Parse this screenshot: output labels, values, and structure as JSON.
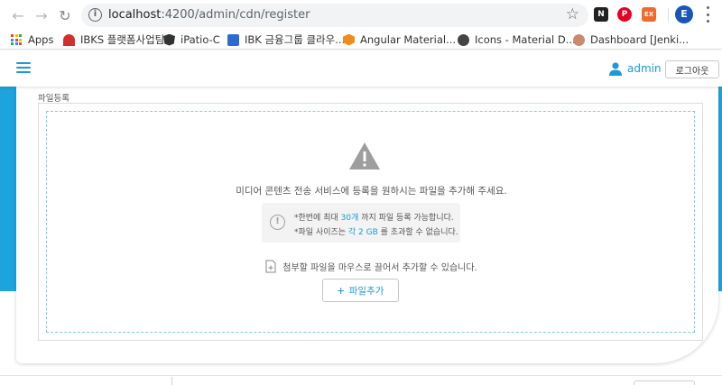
{
  "browser": {
    "url_host": "localhost",
    "url_path": ":4200/admin/cdn/register",
    "profile_initial": "E",
    "ext_notion": "N",
    "ext_pinterest": "P",
    "ext_ex": "EX"
  },
  "bookmarks": [
    {
      "label": "Apps",
      "icon": "apps-grid-icon"
    },
    {
      "label": "IBKS 플랫폼사업팀",
      "icon": "ibks-logo-icon",
      "color": "#d32f2f"
    },
    {
      "label": "iPatio-C",
      "icon": "angular-logo-icon",
      "color": "#333333"
    },
    {
      "label": "IBK 금융그룹 클라우...",
      "icon": "ibk-logo-icon",
      "color": "#2a6bd1"
    },
    {
      "label": "Angular Material...",
      "icon": "angular-material-icon",
      "color": "#ef8d1c"
    },
    {
      "label": "Icons - Material D...",
      "icon": "material-icons-icon",
      "color": "#444444"
    },
    {
      "label": "Dashboard [Jenki...",
      "icon": "jenkins-icon",
      "color": "#c98a6e"
    }
  ],
  "header": {
    "user_name": "admin",
    "logout_label": "로그아웃"
  },
  "register": {
    "section_title": "파일등록",
    "main_message": "미디어 콘텐츠 전송 서비스에 등록을 원하시는 파일을 추가해 주세요.",
    "notice": {
      "line1_prefix": "*한번에 최대 ",
      "line1_highlight": "30개",
      "line1_suffix": " 까지 파일 등록 가능합니다.",
      "line2_prefix": "*파일 사이즈는 ",
      "line2_highlight": "각 2 GB",
      "line2_suffix": " 를 초과할 수 없습니다."
    },
    "drag_message": "첨부할 파일을 마우스로 끌어서 추가할 수 있습니다.",
    "add_button_label": "파일추가"
  },
  "colors": {
    "accent": "#1a9ad6",
    "band": "#1ea4dc"
  }
}
